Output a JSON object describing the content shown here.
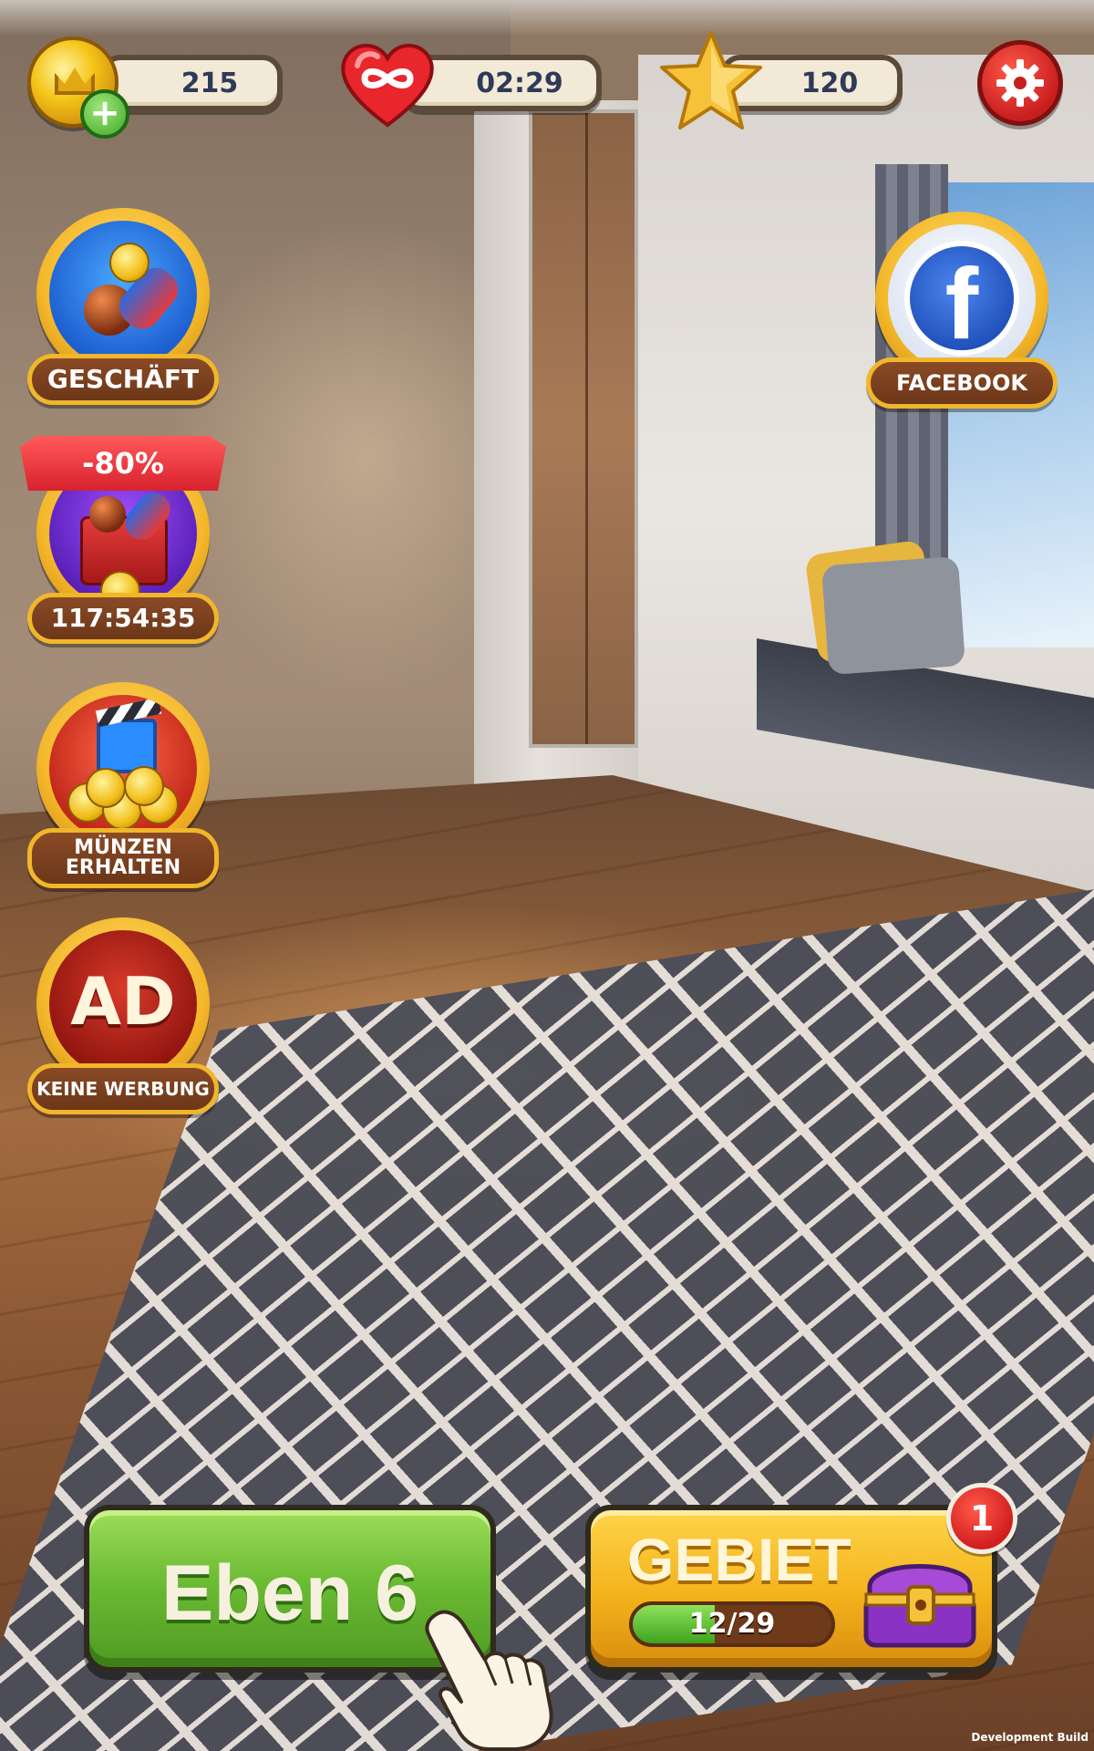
{
  "hud": {
    "coins": "215",
    "lives_timer": "02:29",
    "stars": "120",
    "icons": {
      "coin": "crown-coin-icon",
      "add": "plus-icon",
      "lives": "infinite-heart-icon",
      "stars": "star-icon",
      "settings": "gear-icon"
    }
  },
  "side_menu": {
    "shop_label": "GESCHÄFT",
    "sale_discount": "-80%",
    "sale_timer": "117:54:35",
    "earn_coins_line1": "MÜNZEN",
    "earn_coins_line2": "ERHALTEN",
    "no_ads_icon_text": "AD",
    "no_ads_label": "KEINE WERBUNG",
    "facebook_label": "FACEBOOK",
    "facebook_glyph": "f"
  },
  "bottom": {
    "level_label": "Eben 6",
    "area_label": "GEBIET",
    "area_progress_text": "12/29",
    "area_progress": {
      "current": 12,
      "total": 29
    },
    "area_badge": "1"
  },
  "footer": {
    "build_label": "Development Build"
  },
  "colors": {
    "accent_gold": "#f4b82a",
    "level_green": "#6cbc34",
    "badge_red": "#d21e1e",
    "hud_text": "#2f3a58"
  }
}
